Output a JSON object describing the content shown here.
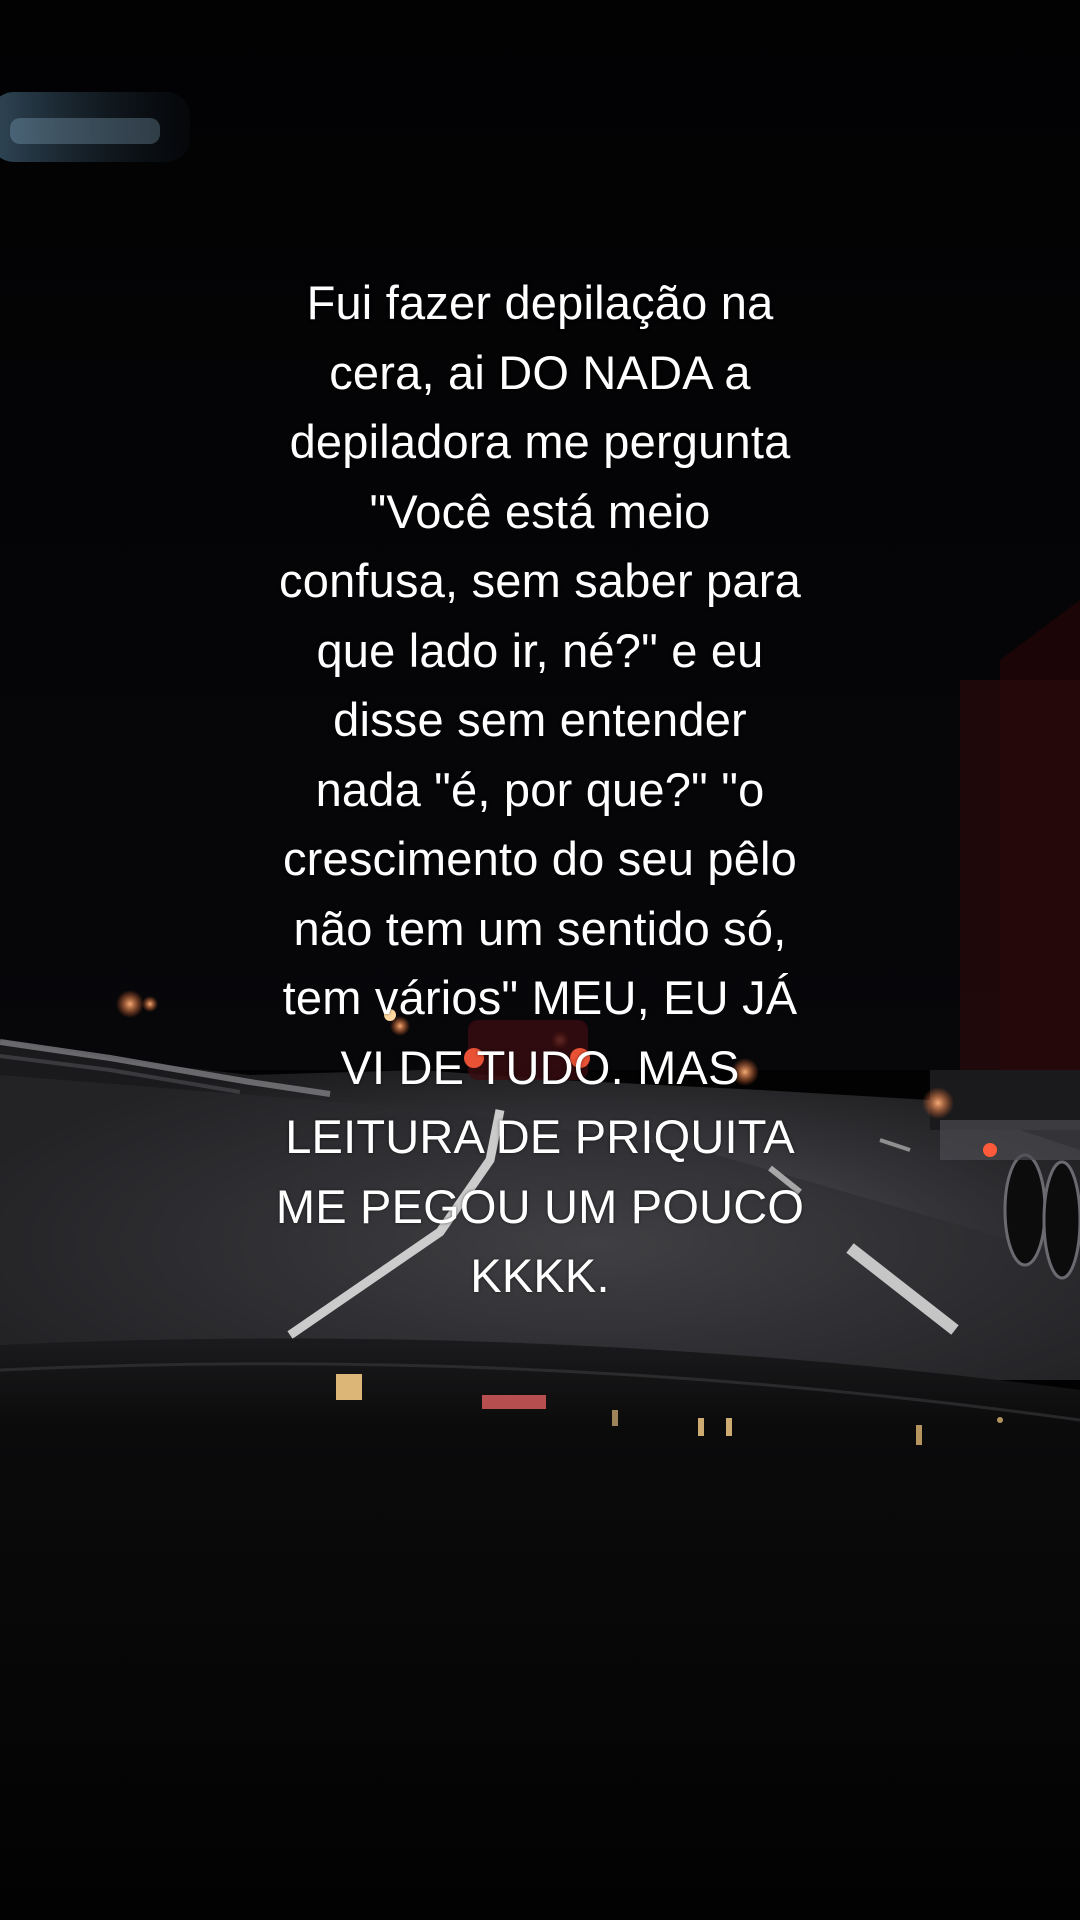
{
  "caption": {
    "lines": [
      "Fui fazer depilação na",
      "cera, ai DO NADA a",
      "depiladora me pergunta",
      "\"Você está meio",
      "confusa, sem saber para",
      "que lado ir, né?\" e eu",
      "disse sem entender",
      "nada \"é, por que?\" \"o",
      "crescimento do seu pêlo",
      "não tem um sentido só,",
      "tem vários\" MEU, EU JÁ",
      "VI DE TUDO. MAS",
      "LEITURA DE PRIQUITA",
      "ME PEGOU UM POUCO",
      "KKKK."
    ]
  },
  "scene": {
    "description_icon": "night-highway-from-car-icon",
    "colors": {
      "sky": "#030304",
      "road": "#3a3a3c",
      "lane_marking": "#d8d8d8",
      "taillight": "#ff4a2a",
      "dashboard": "#050505",
      "mirror_glow": "#9fc8e6"
    }
  }
}
